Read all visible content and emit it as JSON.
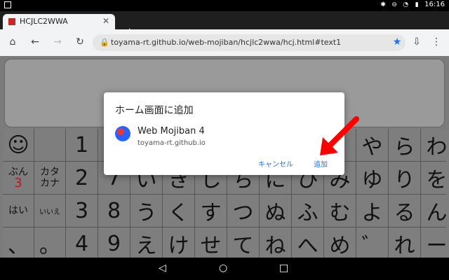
{
  "statusbar": {
    "time": "16:16"
  },
  "browser": {
    "tab_title": "HCJLC2WWA",
    "new_tab": "+",
    "url": "toyama-rt.github.io/web-mojiban/hcjlc2wwa/hcj.html#text1"
  },
  "keyboard": {
    "rows": [
      [
        "☺",
        "",
        "1",
        "",
        "",
        "",
        "",
        "",
        "",
        "",
        "",
        "や",
        "ら",
        "わ"
      ],
      [
        "ぶん\n3",
        "カタ\nカナ",
        "2",
        "7",
        "い",
        "き",
        "し",
        "ち",
        "に",
        "ひ",
        "み",
        "ゆ",
        "り",
        "を"
      ],
      [
        "はい",
        "いいえ",
        "3",
        "8",
        "う",
        "く",
        "す",
        "つ",
        "ぬ",
        "ふ",
        "む",
        "よ",
        "る",
        "ん"
      ],
      [
        "、",
        "。",
        "4",
        "9",
        "え",
        "け",
        "せ",
        "て",
        "ね",
        "へ",
        "め",
        "゛",
        "れ",
        "ー"
      ]
    ]
  },
  "dialog": {
    "title": "ホーム画面に追加",
    "app_name": "Web Mojiban 4",
    "app_url": "toyama-rt.github.io",
    "cancel_label": "キャンセル",
    "add_label": "追加"
  },
  "annotation": {
    "arrow_color": "#ff0000"
  }
}
